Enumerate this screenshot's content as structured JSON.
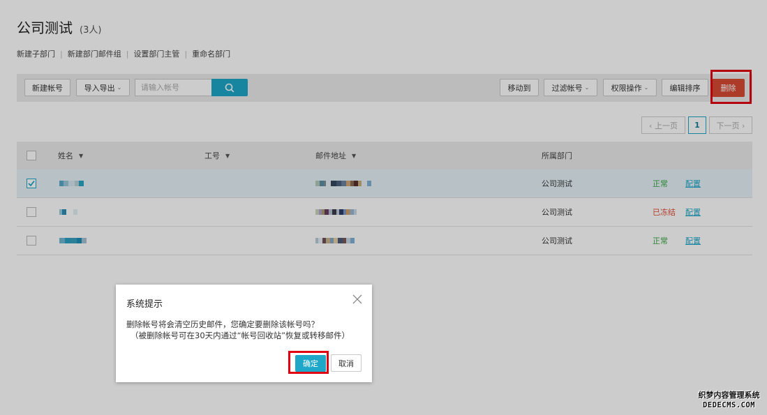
{
  "header": {
    "title": "公司测试",
    "count": "(3人)"
  },
  "dept_actions": [
    "新建子部门",
    "新建部门邮件组",
    "设置部门主管",
    "重命名部门"
  ],
  "toolbar": {
    "new_account": "新建帐号",
    "import_export": "导入导出",
    "search_placeholder": "请输入帐号",
    "move_to": "移动到",
    "filter_accounts": "过滤帐号",
    "permissions": "权限操作",
    "edit_sort": "编辑排序",
    "delete": "删除"
  },
  "pagination": {
    "prev": "‹ 上一页",
    "current": "1",
    "next": "下一页 ›"
  },
  "table": {
    "columns": {
      "name": "姓名",
      "employee_id": "工号",
      "email": "邮件地址",
      "department": "所属部门"
    },
    "rows": [
      {
        "selected": true,
        "department": "公司测试",
        "status": "正常",
        "status_type": "ok",
        "action": "配置"
      },
      {
        "selected": false,
        "department": "公司测试",
        "status": "已冻结",
        "status_type": "frozen",
        "action": "配置"
      },
      {
        "selected": false,
        "department": "公司测试",
        "status": "正常",
        "status_type": "ok",
        "action": "配置"
      }
    ]
  },
  "dialog": {
    "title": "系统提示",
    "message": "删除帐号将会清空历史邮件，您确定要删除该帐号吗？",
    "note": "（被删除帐号可在30天内通过“帐号回收站”恢复或转移邮件）",
    "confirm": "确定",
    "cancel": "取消"
  },
  "watermark": {
    "line1": "织梦内容管理系统",
    "line2": "DEDECMS.COM"
  },
  "colors": {
    "accent": "#1ea7c9",
    "danger": "#d84c34",
    "highlight": "#e00012",
    "status_ok": "#3aa545",
    "status_frozen": "#e24b36"
  },
  "icons": [
    "search-icon",
    "close-icon",
    "checkmark-icon",
    "chevron-down-icon",
    "sort-caret-icon"
  ]
}
